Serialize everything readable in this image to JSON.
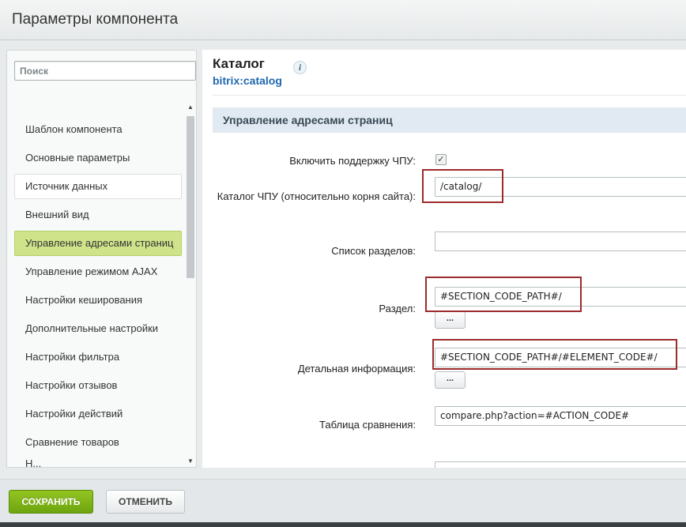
{
  "window": {
    "title": "Параметры компонента"
  },
  "sidebar": {
    "search_placeholder": "Поиск",
    "items": [
      {
        "label": "Шаблон компонента"
      },
      {
        "label": "Основные параметры"
      },
      {
        "label": "Источник данных"
      },
      {
        "label": "Внешний вид"
      },
      {
        "label": "Управление адресами страниц"
      },
      {
        "label": "Управление режимом AJAX"
      },
      {
        "label": "Настройки кеширования"
      },
      {
        "label": "Дополнительные настройки"
      },
      {
        "label": "Настройки фильтра"
      },
      {
        "label": "Настройки отзывов"
      },
      {
        "label": "Настройки действий"
      },
      {
        "label": "Сравнение товаров"
      },
      {
        "label": "Н..."
      }
    ],
    "active_item": "Управление адресами страниц",
    "hover_item": "Источник данных"
  },
  "component": {
    "title": "Каталог",
    "code": "bitrix:catalog",
    "info_icon": "i"
  },
  "section": {
    "title": "Управление адресами страниц",
    "fields": {
      "sef_enable": {
        "label": "Включить поддержку ЧПУ:",
        "checked": true,
        "check_glyph": "✓"
      },
      "sef_folder": {
        "label": "Каталог ЧПУ (относительно корня сайта):",
        "value": "/catalog/"
      },
      "sections_list": {
        "label": "Список разделов:",
        "value": ""
      },
      "section": {
        "label": "Раздел:",
        "value": "#SECTION_CODE_PATH#/",
        "button": "..."
      },
      "detail": {
        "label": "Детальная информация:",
        "value": "#SECTION_CODE_PATH#/#ELEMENT_CODE#/",
        "button": "..."
      },
      "compare": {
        "label": "Таблица сравнения:",
        "value": "compare.php?action=#ACTION_CODE#"
      }
    }
  },
  "footer": {
    "save_label": "СОХРАНИТЬ",
    "cancel_label": "ОТМЕНИТЬ"
  },
  "colors": {
    "accent_green": "#7ab317",
    "link_blue": "#2067b0",
    "highlight_red": "#9c2b2b",
    "active_item": "#cfe48a"
  }
}
